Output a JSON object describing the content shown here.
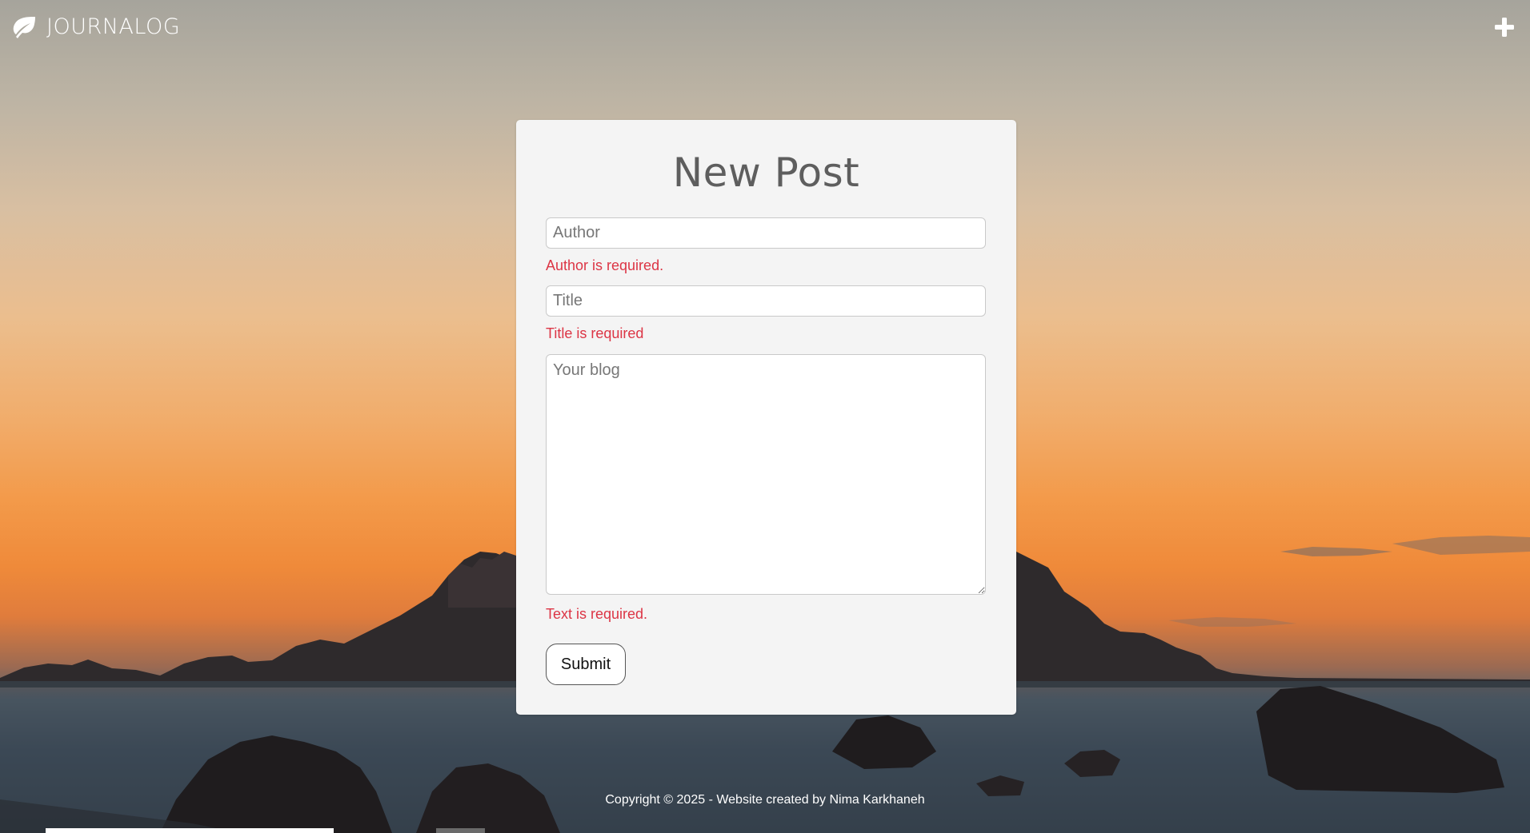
{
  "navbar": {
    "brand": "JOURNALOG",
    "brand_icon": "leaf-icon",
    "add_icon": "plus-icon"
  },
  "form": {
    "title": "New Post",
    "author_placeholder": "Author",
    "author_error": "Author is required.",
    "title_placeholder": "Title",
    "title_error": "Title is required",
    "text_placeholder": "Your blog",
    "text_error": "Text is required.",
    "submit_label": "Submit"
  },
  "footer": {
    "copyright": "Copyright © 2025 - Website created by Nima Karkhaneh"
  },
  "colors": {
    "error": "#dc3545",
    "card": "#f4f4f4",
    "title": "#5e5e5e"
  }
}
